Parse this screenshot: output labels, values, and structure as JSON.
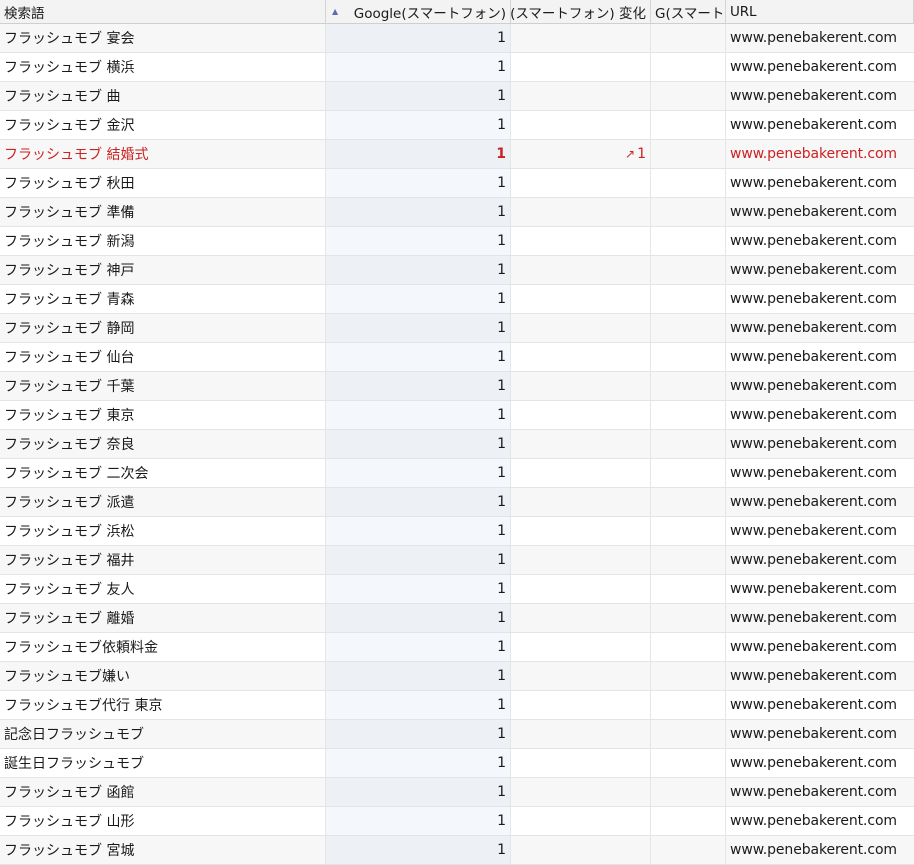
{
  "header": {
    "keyword": "検索語",
    "google": "Google(スマートフォン)",
    "google_change": "G(スマートフォン) 変化",
    "google_prev": "G(スマートフ...",
    "url": "URL",
    "sort_icon": "▲"
  },
  "rows": [
    {
      "keyword": "フラッシュモブ 宴会",
      "rank": "1",
      "change": "",
      "url": "www.penebakerent.com"
    },
    {
      "keyword": "フラッシュモブ 横浜",
      "rank": "1",
      "change": "",
      "url": "www.penebakerent.com"
    },
    {
      "keyword": "フラッシュモブ 曲",
      "rank": "1",
      "change": "",
      "url": "www.penebakerent.com"
    },
    {
      "keyword": "フラッシュモブ 金沢",
      "rank": "1",
      "change": "",
      "url": "www.penebakerent.com"
    },
    {
      "keyword": "フラッシュモブ 結婚式",
      "rank": "1",
      "change": "1",
      "url": "www.penebakerent.com",
      "highlight": true
    },
    {
      "keyword": "フラッシュモブ 秋田",
      "rank": "1",
      "change": "",
      "url": "www.penebakerent.com"
    },
    {
      "keyword": "フラッシュモブ 準備",
      "rank": "1",
      "change": "",
      "url": "www.penebakerent.com"
    },
    {
      "keyword": "フラッシュモブ 新潟",
      "rank": "1",
      "change": "",
      "url": "www.penebakerent.com"
    },
    {
      "keyword": "フラッシュモブ 神戸",
      "rank": "1",
      "change": "",
      "url": "www.penebakerent.com"
    },
    {
      "keyword": "フラッシュモブ 青森",
      "rank": "1",
      "change": "",
      "url": "www.penebakerent.com"
    },
    {
      "keyword": "フラッシュモブ 静岡",
      "rank": "1",
      "change": "",
      "url": "www.penebakerent.com"
    },
    {
      "keyword": "フラッシュモブ 仙台",
      "rank": "1",
      "change": "",
      "url": "www.penebakerent.com"
    },
    {
      "keyword": "フラッシュモブ 千葉",
      "rank": "1",
      "change": "",
      "url": "www.penebakerent.com"
    },
    {
      "keyword": "フラッシュモブ 東京",
      "rank": "1",
      "change": "",
      "url": "www.penebakerent.com"
    },
    {
      "keyword": "フラッシュモブ 奈良",
      "rank": "1",
      "change": "",
      "url": "www.penebakerent.com"
    },
    {
      "keyword": "フラッシュモブ 二次会",
      "rank": "1",
      "change": "",
      "url": "www.penebakerent.com"
    },
    {
      "keyword": "フラッシュモブ 派遣",
      "rank": "1",
      "change": "",
      "url": "www.penebakerent.com"
    },
    {
      "keyword": "フラッシュモブ 浜松",
      "rank": "1",
      "change": "",
      "url": "www.penebakerent.com"
    },
    {
      "keyword": "フラッシュモブ 福井",
      "rank": "1",
      "change": "",
      "url": "www.penebakerent.com"
    },
    {
      "keyword": "フラッシュモブ 友人",
      "rank": "1",
      "change": "",
      "url": "www.penebakerent.com"
    },
    {
      "keyword": "フラッシュモブ 離婚",
      "rank": "1",
      "change": "",
      "url": "www.penebakerent.com"
    },
    {
      "keyword": "フラッシュモブ依頼料金",
      "rank": "1",
      "change": "",
      "url": "www.penebakerent.com"
    },
    {
      "keyword": "フラッシュモブ嫌い",
      "rank": "1",
      "change": "",
      "url": "www.penebakerent.com"
    },
    {
      "keyword": "フラッシュモブ代行 東京",
      "rank": "1",
      "change": "",
      "url": "www.penebakerent.com"
    },
    {
      "keyword": "記念日フラッシュモブ",
      "rank": "1",
      "change": "",
      "url": "www.penebakerent.com"
    },
    {
      "keyword": "誕生日フラッシュモブ",
      "rank": "1",
      "change": "",
      "url": "www.penebakerent.com"
    },
    {
      "keyword": "フラッシュモブ 函館",
      "rank": "1",
      "change": "",
      "url": "www.penebakerent.com"
    },
    {
      "keyword": "フラッシュモブ 山形",
      "rank": "1",
      "change": "",
      "url": "www.penebakerent.com"
    },
    {
      "keyword": "フラッシュモブ 宮城",
      "rank": "1",
      "change": "",
      "url": "www.penebakerent.com"
    }
  ],
  "colors": {
    "highlight": "#cc2222",
    "rank_column_bg": "#f4f7fb"
  }
}
